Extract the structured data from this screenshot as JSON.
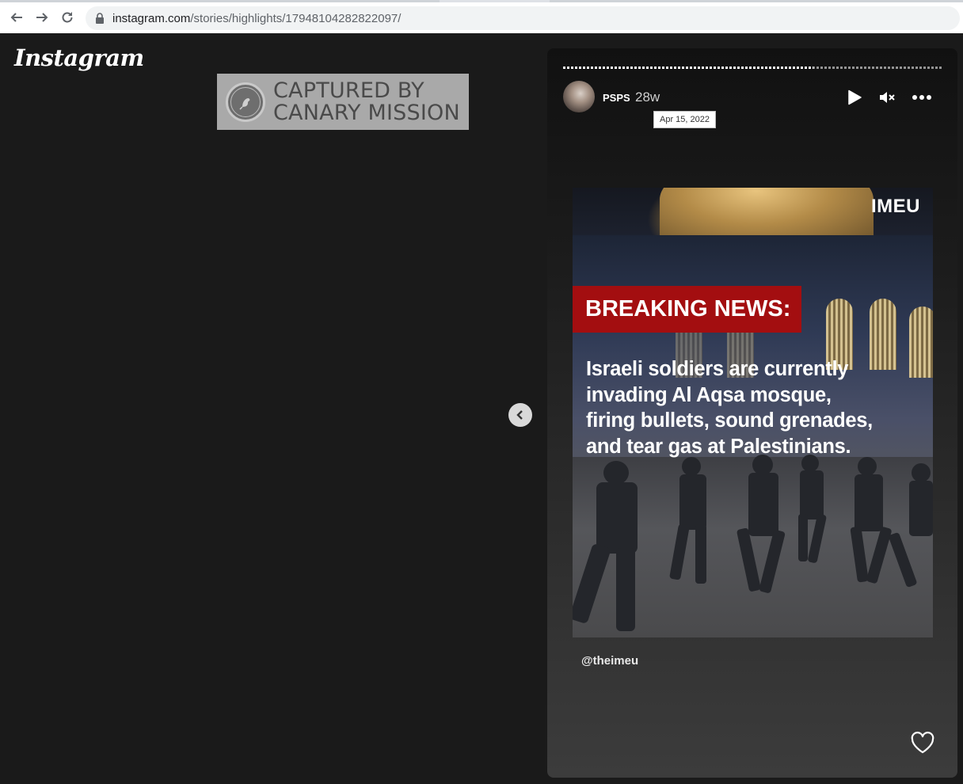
{
  "browser": {
    "url_host": "instagram.com",
    "url_path": "/stories/highlights/17948104282822097/"
  },
  "app": {
    "logo_text": "Instagram"
  },
  "watermark": {
    "line1": "CAPTURED BY",
    "line2": "CANARY MISSION"
  },
  "story": {
    "progress_fraction": 0.66,
    "username": "PSPS",
    "time_ago": "28w",
    "date_tooltip": "Apr 15, 2022",
    "image": {
      "brand": "IMEU",
      "banner": "BREAKING NEWS:",
      "headline_lines": [
        "Israeli soldiers are currently",
        "invading Al Aqsa mosque,",
        "firing bullets, sound grenades,",
        "and tear gas at Palestinians."
      ]
    },
    "mention": "@theimeu"
  },
  "icons": {
    "back": "arrow-left-icon",
    "forward": "arrow-right-icon",
    "reload": "reload-icon",
    "lock": "lock-icon",
    "play": "play-icon",
    "mute": "muted-speaker-icon",
    "more": "more-options-icon",
    "prev": "chevron-left-icon",
    "like": "heart-icon"
  },
  "colors": {
    "page_bg": "#1a1a1a",
    "banner_red": "#a30e10",
    "watermark_bg": "#a9a9a9"
  }
}
